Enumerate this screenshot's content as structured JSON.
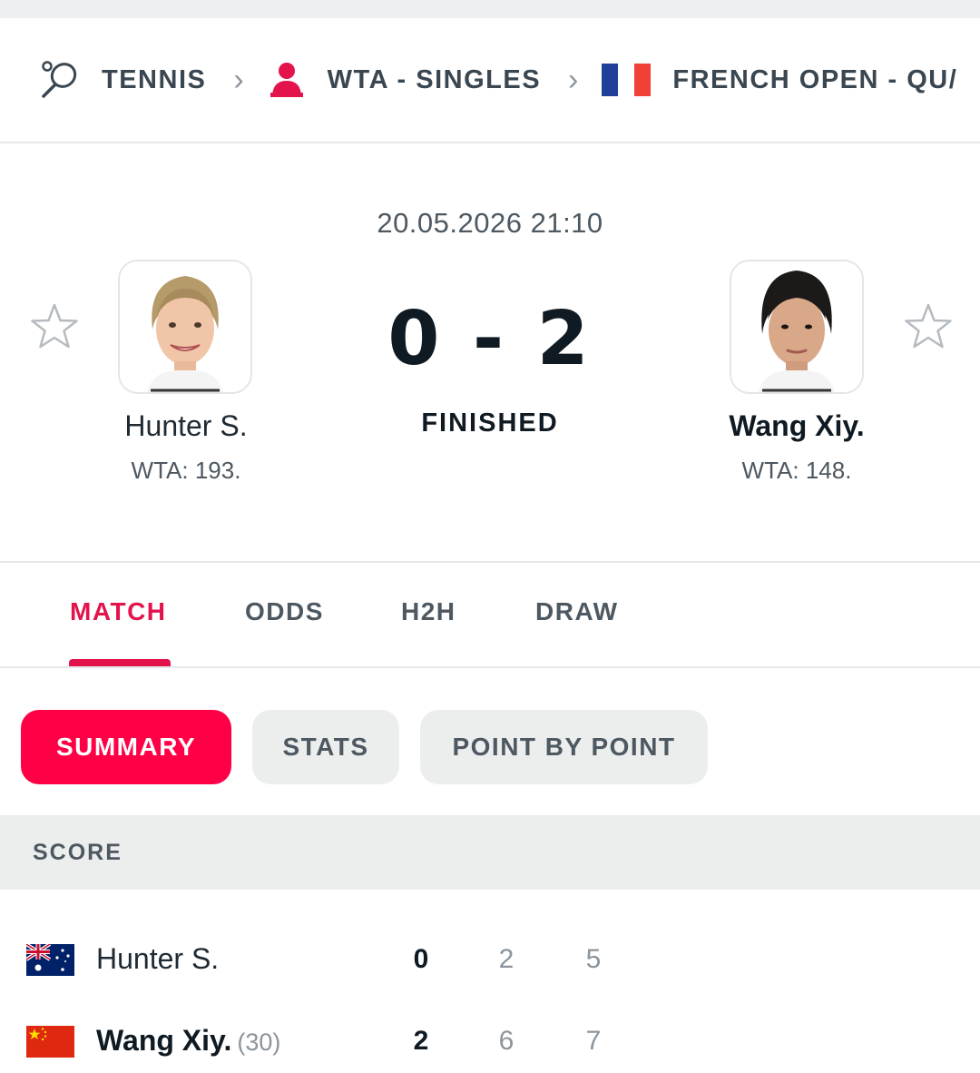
{
  "breadcrumb": {
    "sport": "TENNIS",
    "category": "WTA - SINGLES",
    "tournament": "FRENCH OPEN - QU/"
  },
  "match": {
    "datetime": "20.05.2026 21:10",
    "score_home": "0",
    "score_separator": "-",
    "score_away": "2",
    "status": "FINISHED",
    "home": {
      "name": "Hunter S.",
      "rank": "WTA: 193."
    },
    "away": {
      "name": "Wang Xiy.",
      "rank": "WTA: 148."
    }
  },
  "tabs": [
    {
      "label": "MATCH",
      "active": true
    },
    {
      "label": "ODDS",
      "active": false
    },
    {
      "label": "H2H",
      "active": false
    },
    {
      "label": "DRAW",
      "active": false
    }
  ],
  "subtabs": [
    {
      "label": "SUMMARY",
      "active": true
    },
    {
      "label": "STATS",
      "active": false
    },
    {
      "label": "POINT BY POINT",
      "active": false
    }
  ],
  "score": {
    "header": "SCORE",
    "rows": [
      {
        "name": "Hunter S.",
        "seed": "",
        "flag": "australia-flag",
        "sets": "0",
        "set1": "2",
        "set2": "5"
      },
      {
        "name": "Wang Xiy.",
        "seed": "(30)",
        "flag": "china-flag",
        "sets": "2",
        "set1": "6",
        "set2": "7"
      }
    ]
  },
  "colors": {
    "accent": "#e3134c",
    "pill_active": "#ff0046",
    "pill_inactive": "#eceded"
  }
}
